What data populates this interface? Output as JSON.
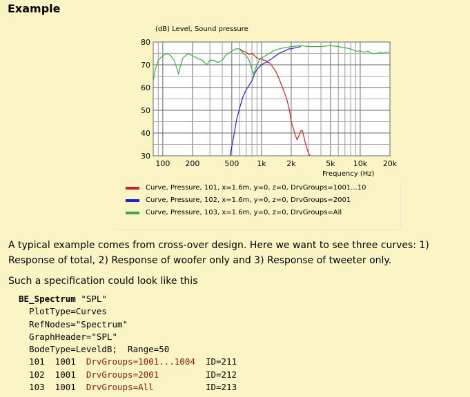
{
  "heading": "Example",
  "chart_data": {
    "type": "line",
    "title": "(dB)  Level, Sound pressure",
    "xlabel": "Frequency  (Hz)",
    "ylabel": "(dB)",
    "x_scale": "log",
    "xlim": [
      80,
      20000
    ],
    "ylim": [
      30,
      80
    ],
    "x_ticks": [
      100,
      200,
      500,
      1000,
      2000,
      5000,
      10000,
      20000
    ],
    "x_tick_labels": [
      "100",
      "200",
      "500",
      "1k",
      "2k",
      "5k",
      "10k",
      "20k"
    ],
    "y_ticks": [
      30,
      40,
      50,
      60,
      70,
      80
    ],
    "y_tick_labels": [
      "30",
      "40",
      "50",
      "60",
      "70",
      "80"
    ],
    "grid": true,
    "series": [
      {
        "name": "Curve, Pressure, 101, x=1.6m, y=0, z=0, DrvGroups=1001...10",
        "color": "#cc2020",
        "points": [
          [
            600,
            77
          ],
          [
            650,
            76
          ],
          [
            700,
            75.5
          ],
          [
            750,
            74.5
          ],
          [
            800,
            75
          ],
          [
            850,
            74
          ],
          [
            900,
            73
          ],
          [
            950,
            72.5
          ],
          [
            1000,
            73
          ],
          [
            1050,
            72
          ],
          [
            1100,
            72
          ],
          [
            1150,
            71
          ],
          [
            1200,
            71
          ],
          [
            1300,
            69
          ],
          [
            1400,
            67
          ],
          [
            1500,
            64
          ],
          [
            1600,
            61
          ],
          [
            1700,
            58
          ],
          [
            1800,
            55
          ],
          [
            1900,
            51
          ],
          [
            2000,
            45
          ],
          [
            2100,
            42
          ],
          [
            2200,
            39
          ],
          [
            2300,
            37
          ],
          [
            2400,
            39
          ],
          [
            2500,
            41
          ],
          [
            2600,
            41
          ],
          [
            2700,
            38
          ],
          [
            2800,
            35
          ],
          [
            2900,
            33
          ],
          [
            3000,
            31
          ],
          [
            3100,
            30
          ]
        ]
      },
      {
        "name": "Curve, Pressure, 102, x=1.6m, y=0, z=0, DrvGroups=2001",
        "color": "#2020cc",
        "points": [
          [
            480,
            30
          ],
          [
            500,
            34
          ],
          [
            530,
            40
          ],
          [
            560,
            46
          ],
          [
            600,
            51
          ],
          [
            650,
            56
          ],
          [
            700,
            59
          ],
          [
            750,
            61
          ],
          [
            800,
            63
          ],
          [
            850,
            66
          ],
          [
            900,
            68
          ],
          [
            950,
            69
          ],
          [
            1000,
            70
          ],
          [
            1100,
            71
          ],
          [
            1200,
            72
          ],
          [
            1300,
            73
          ],
          [
            1400,
            74
          ],
          [
            1500,
            75
          ],
          [
            1600,
            75.5
          ],
          [
            1700,
            76
          ],
          [
            1800,
            76.5
          ],
          [
            1900,
            77
          ],
          [
            2000,
            77
          ],
          [
            2200,
            77.5
          ],
          [
            2500,
            78
          ]
        ]
      },
      {
        "name": "Curve, Pressure, 103, x=1.6m, y=0, z=0, DrvGroups=All",
        "color": "#40aa40",
        "points": [
          [
            80,
            63
          ],
          [
            84,
            68
          ],
          [
            90,
            72
          ],
          [
            100,
            74
          ],
          [
            110,
            75
          ],
          [
            120,
            74
          ],
          [
            130,
            72
          ],
          [
            140,
            68
          ],
          [
            145,
            66
          ],
          [
            150,
            69
          ],
          [
            160,
            73
          ],
          [
            180,
            75
          ],
          [
            200,
            74
          ],
          [
            220,
            73
          ],
          [
            250,
            72
          ],
          [
            280,
            70
          ],
          [
            300,
            72
          ],
          [
            330,
            72
          ],
          [
            360,
            71
          ],
          [
            400,
            72
          ],
          [
            430,
            74
          ],
          [
            460,
            75
          ],
          [
            500,
            76
          ],
          [
            550,
            77
          ],
          [
            600,
            77
          ],
          [
            650,
            75
          ],
          [
            700,
            74
          ],
          [
            750,
            72
          ],
          [
            800,
            68
          ],
          [
            830,
            66
          ],
          [
            850,
            67
          ],
          [
            900,
            70
          ],
          [
            950,
            72
          ],
          [
            1000,
            73
          ],
          [
            1100,
            74
          ],
          [
            1200,
            75
          ],
          [
            1300,
            76
          ],
          [
            1500,
            77
          ],
          [
            1700,
            77.5
          ],
          [
            2000,
            78
          ],
          [
            2500,
            78.5
          ],
          [
            3000,
            78
          ],
          [
            4000,
            78
          ],
          [
            5000,
            78.5
          ],
          [
            6000,
            78
          ],
          [
            7000,
            77.5
          ],
          [
            8000,
            77
          ],
          [
            9000,
            76
          ],
          [
            10000,
            76
          ],
          [
            11000,
            75.5
          ],
          [
            12000,
            76
          ],
          [
            13000,
            75
          ],
          [
            14000,
            75
          ],
          [
            15000,
            75
          ],
          [
            16000,
            75.5
          ],
          [
            17000,
            75
          ],
          [
            18000,
            75.5
          ],
          [
            20000,
            75.5
          ]
        ]
      }
    ]
  },
  "paragraph1": "A typical example comes from cross-over design. Here we want to see three curves: 1) Response of total, 2) Response of woofer only and 3) Response of tweeter only.",
  "paragraph2": "Such a specification could look like this",
  "code": {
    "kw": "BE_Spectrum",
    "name": " \"SPL\"",
    "line2": "  PlotType=Curves",
    "line3": "  RefNodes=\"Spectrum\"",
    "line4": "  GraphHeader=\"SPL\"",
    "line5": "  BodeType=LeveldB;  Range=50",
    "rows": [
      {
        "a": "  101  1001  ",
        "b": "DrvGroups=1001...1004",
        "c": "  ID=211"
      },
      {
        "a": "  102  1001  ",
        "b": "DrvGroups=2001",
        "c": "         ID=212"
      },
      {
        "a": "  103  1001  ",
        "b": "DrvGroups=All",
        "c": "          ID=213"
      }
    ]
  }
}
